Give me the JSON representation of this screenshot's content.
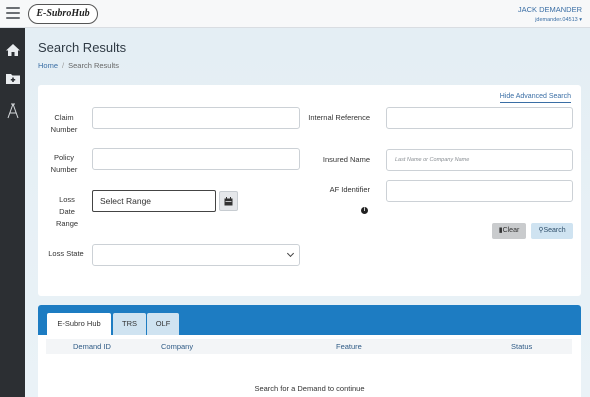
{
  "header": {
    "logo_text": "E-SubroHub",
    "user_name": "JACK DEMANDER",
    "user_id": "jdemander.04513"
  },
  "sidebar": {
    "items": [
      {
        "icon": "home-icon"
      },
      {
        "icon": "folder-plus-icon"
      },
      {
        "icon": "af-logo-icon"
      }
    ]
  },
  "page": {
    "title": "Search Results",
    "breadcrumb": {
      "home": "Home",
      "separator": "/",
      "current": "Search Results"
    }
  },
  "search_form": {
    "hide_advanced_label": "Hide Advanced Search",
    "claim_number_label": "Claim Number",
    "policy_number_label": "Policy Number",
    "loss_date_range_label": "Loss Date Range",
    "loss_date_range_value": "Select Range",
    "loss_state_label": "Loss State",
    "loss_state_value": "",
    "internal_reference_label": "Internal Reference",
    "insured_name_label": "Insured Name",
    "insured_name_placeholder": "Last Name or Company Name",
    "af_identifier_label": "AF Identifier",
    "clear_label": "Clear",
    "search_label": "Search"
  },
  "results": {
    "tabs": [
      {
        "label": "E-Subro Hub",
        "active": true
      },
      {
        "label": "TRS",
        "active": false
      },
      {
        "label": "OLF",
        "active": false
      }
    ],
    "columns": [
      "Demand ID",
      "Company",
      "Feature",
      "Status"
    ],
    "empty_message": "Search for a Demand to continue"
  },
  "colors": {
    "accent": "#1d7cc2",
    "link": "#3a6ea5",
    "sidebar": "#2c2f33"
  }
}
